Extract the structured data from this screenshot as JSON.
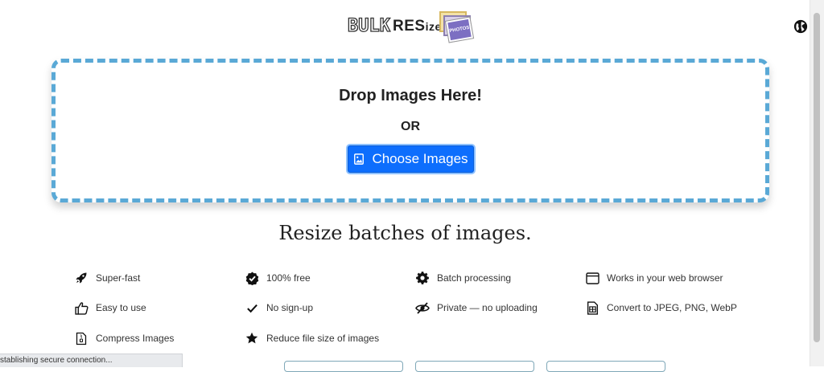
{
  "header": {
    "logo": {
      "bulk": "BULK",
      "resize_main": "RES",
      "resize_small": "ize",
      "photos": "PHOTOS"
    }
  },
  "dropzone": {
    "title": "Drop Images Here!",
    "or": "OR",
    "choose_label": "Choose Images"
  },
  "tagline": "Resize batches of images.",
  "features": [
    {
      "label": "Super-fast",
      "icon": "rocket-icon"
    },
    {
      "label": "100% free",
      "icon": "verified-badge-icon"
    },
    {
      "label": "Batch processing",
      "icon": "gear-icon"
    },
    {
      "label": "Works in your web browser",
      "icon": "browser-window-icon"
    },
    {
      "label": "Easy to use",
      "icon": "thumbs-up-icon"
    },
    {
      "label": "No sign-up",
      "icon": "checkmark-icon"
    },
    {
      "label": "Private — no uploading",
      "icon": "eye-slash-icon"
    },
    {
      "label": "Convert to JPEG, PNG, WebP",
      "icon": "file-convert-icon"
    },
    {
      "label": "Compress Images",
      "icon": "file-zip-icon"
    },
    {
      "label": "Reduce file size of images",
      "icon": "star-icon"
    }
  ],
  "status_bar": {
    "text": "stablishing secure connection..."
  },
  "colors": {
    "accent": "#0d6efd",
    "dropzone_border": "#5aa9d6"
  }
}
